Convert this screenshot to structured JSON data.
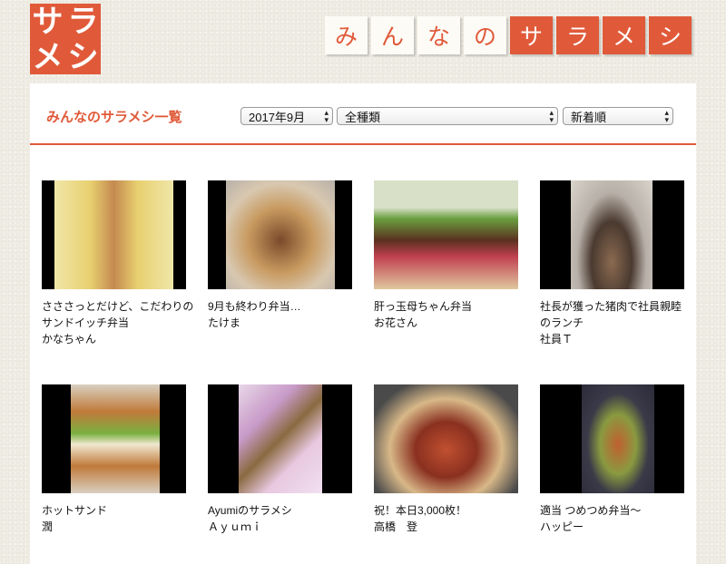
{
  "logo": {
    "chars": [
      "サ",
      "ラ",
      "メ",
      "シ"
    ]
  },
  "site_title_tiles": [
    "み",
    "ん",
    "な",
    "の",
    "サ",
    "ラ",
    "メ",
    "シ"
  ],
  "brand_color": "#e05a3a",
  "panel": {
    "title": "みんなのサラメシ一覧",
    "filters": {
      "month": "2017年9月",
      "category": "全種類",
      "sort": "新着順"
    }
  },
  "posts": [
    {
      "title_lines": [
        "さささっとだけど、こだわりの",
        "サンドイッチ弁当"
      ],
      "author": "かなちゃん"
    },
    {
      "title_lines": [
        "9月も終わり弁当…"
      ],
      "author": "たけま"
    },
    {
      "title_lines": [
        "肝っ玉母ちゃん弁当"
      ],
      "author": "お花さん"
    },
    {
      "title_lines": [
        "社長が獲った猪肉で社員親睦",
        "のランチ"
      ],
      "author": "社員Ｔ"
    },
    {
      "title_lines": [
        "ホットサンド"
      ],
      "author": "潤"
    },
    {
      "title_lines": [
        "Ayumiのサラメシ"
      ],
      "author": "Ａｙｕｍｉ"
    },
    {
      "title_lines": [
        "祝！本日3,000枚！"
      ],
      "author": "高橋　登"
    },
    {
      "title_lines": [
        "適当 つめつめ弁当～"
      ],
      "author": "ハッピー"
    }
  ]
}
